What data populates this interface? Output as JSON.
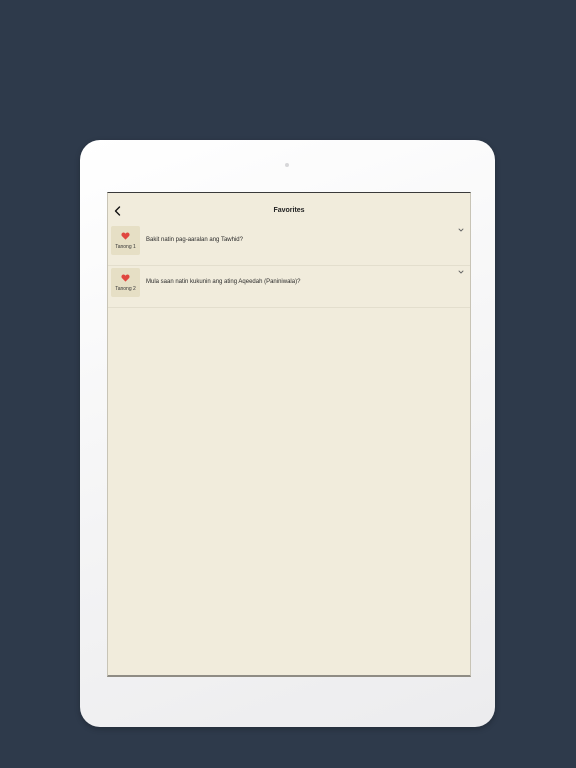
{
  "nav": {
    "title": "Favorites",
    "back_icon": "chevron-left-icon"
  },
  "favorites": [
    {
      "badge_label": "Tanong 1",
      "question": "Bakit natin pag-aaralan ang Tawhid?",
      "icon": "heart-icon"
    },
    {
      "badge_label": "Tanong 2",
      "question": "Mula saan natin kukunin ang ating Aqeedah (Paniniwala)?",
      "icon": "heart-icon"
    }
  ],
  "colors": {
    "background": "#2e3a4b",
    "screen": "#f1ecdc",
    "badge": "#e6dfc5",
    "heart": "#e0463f"
  }
}
